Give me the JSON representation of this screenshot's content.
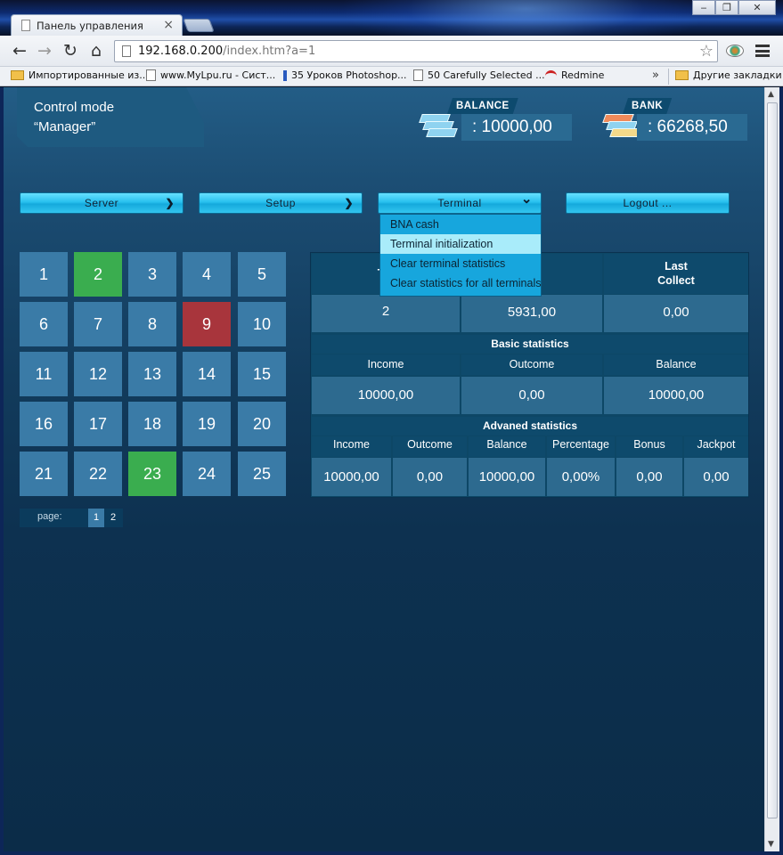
{
  "browser": {
    "tab_title": "Панель управления",
    "tab_close": "×",
    "window_buttons": [
      "‒",
      "❐",
      "✕"
    ],
    "url_host": "192.168.0.200",
    "url_path": "/index.htm?a=1",
    "bookmarks": [
      {
        "label": "Импортированные из...",
        "icon": "folder-icon"
      },
      {
        "label": "www.MyLpu.ru - Сист...",
        "icon": "page-icon"
      },
      {
        "label": "35 Уроков Photoshop...",
        "icon": "photoshop-icon"
      },
      {
        "label": "50 Carefully Selected ...",
        "icon": "page-icon"
      },
      {
        "label": "Redmine",
        "icon": "redmine-icon"
      },
      {
        "label": "Другие закладки",
        "icon": "folder-icon"
      }
    ],
    "bookmarks_more": "»"
  },
  "header": {
    "mode_line1": "Control mode",
    "mode_line2": "“Manager”",
    "balance_label": "BALANCE",
    "balance_value": ": 10000,00",
    "bank_label": "BANK",
    "bank_value": ": 66268,50"
  },
  "menu": {
    "server": "Server",
    "setup": "Setup",
    "terminal": "Terminal",
    "logout": "Logout ...",
    "chevron_right": "❯",
    "chevron_down": "⌄",
    "terminal_items": [
      "BNA cash",
      "Terminal initialization",
      "Clear terminal statistics",
      "Clear statistics for all terminals"
    ],
    "active_item": "Terminal initialization"
  },
  "terminals": {
    "cells": [
      {
        "n": "1",
        "status": "normal"
      },
      {
        "n": "2",
        "status": "green"
      },
      {
        "n": "3",
        "status": "normal"
      },
      {
        "n": "4",
        "status": "normal"
      },
      {
        "n": "5",
        "status": "normal"
      },
      {
        "n": "6",
        "status": "normal"
      },
      {
        "n": "7",
        "status": "normal"
      },
      {
        "n": "8",
        "status": "normal"
      },
      {
        "n": "9",
        "status": "red"
      },
      {
        "n": "10",
        "status": "normal"
      },
      {
        "n": "11",
        "status": "normal"
      },
      {
        "n": "12",
        "status": "normal"
      },
      {
        "n": "13",
        "status": "normal"
      },
      {
        "n": "14",
        "status": "normal"
      },
      {
        "n": "15",
        "status": "normal"
      },
      {
        "n": "16",
        "status": "normal"
      },
      {
        "n": "17",
        "status": "normal"
      },
      {
        "n": "18",
        "status": "normal"
      },
      {
        "n": "19",
        "status": "normal"
      },
      {
        "n": "20",
        "status": "normal"
      },
      {
        "n": "21",
        "status": "normal"
      },
      {
        "n": "22",
        "status": "normal"
      },
      {
        "n": "23",
        "status": "green"
      },
      {
        "n": "24",
        "status": "normal"
      },
      {
        "n": "25",
        "status": "normal"
      }
    ],
    "page_label": "page:",
    "pages": [
      "1",
      "2"
    ],
    "current_page": "1"
  },
  "stats": {
    "top_headers": [
      "Ter",
      "dit",
      "Last\nCollect"
    ],
    "top_values": [
      "2",
      "5931,00",
      "0,00"
    ],
    "basic_title": "Basic statistics",
    "basic_headers": [
      "Income",
      "Outcome",
      "Balance"
    ],
    "basic_values": [
      "10000,00",
      "0,00",
      "10000,00"
    ],
    "adv_title": "Advaned statistics",
    "adv_headers": [
      "Income",
      "Outcome",
      "Balance",
      "Percentage",
      "Bonus",
      "Jackpot"
    ],
    "adv_values": [
      "10000,00",
      "0,00",
      "10000,00",
      "0,00%",
      "0,00",
      "0,00"
    ]
  },
  "colors": {
    "tile": "#3a7ba7",
    "tile_active": "#3aad4f",
    "tile_error": "#a8353c",
    "button": "#28c0ee",
    "dropdown": "#17a6dd",
    "dropdown_active": "#a9ecfa"
  }
}
